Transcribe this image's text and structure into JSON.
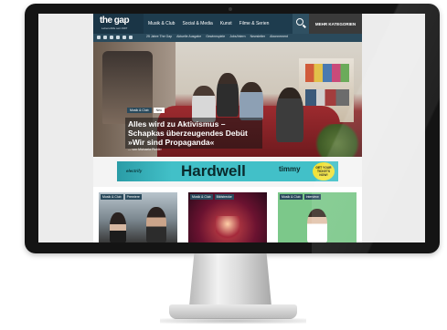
{
  "header": {
    "logo_text": "the gap",
    "logo_sub": "Lebenshilfe seit 1997",
    "nav": [
      "Musik & Club",
      "Social & Media",
      "Kunst",
      "Filme & Serien"
    ],
    "categories_button": "MEHR KATEGORIEN"
  },
  "subbar": {
    "links": [
      "25 Jahre The Gap",
      "Aktuelle Ausgabe",
      "Gewinnspiele",
      "Jobs/Intern",
      "Newsletter",
      "Abonnement"
    ]
  },
  "hero": {
    "tags": [
      "Musik & Club",
      "Neu"
    ],
    "title": "Alles wird zu Aktivismus – Schapkas überzeugendes Debüt »Wir sind Propaganda«",
    "author": "— von Michaela Pichler"
  },
  "ad": {
    "brand": "electrify",
    "headline": "Hardwell",
    "side": "timmy",
    "cta": "GET YOUR TICKETS NOW!"
  },
  "cards": [
    {
      "tags": [
        "Musik & Club",
        "Premiere"
      ]
    },
    {
      "tags": [
        "Musik & Club",
        "Bildstrecke"
      ]
    },
    {
      "tags": [
        "Musik & Club",
        "Interview"
      ]
    }
  ]
}
